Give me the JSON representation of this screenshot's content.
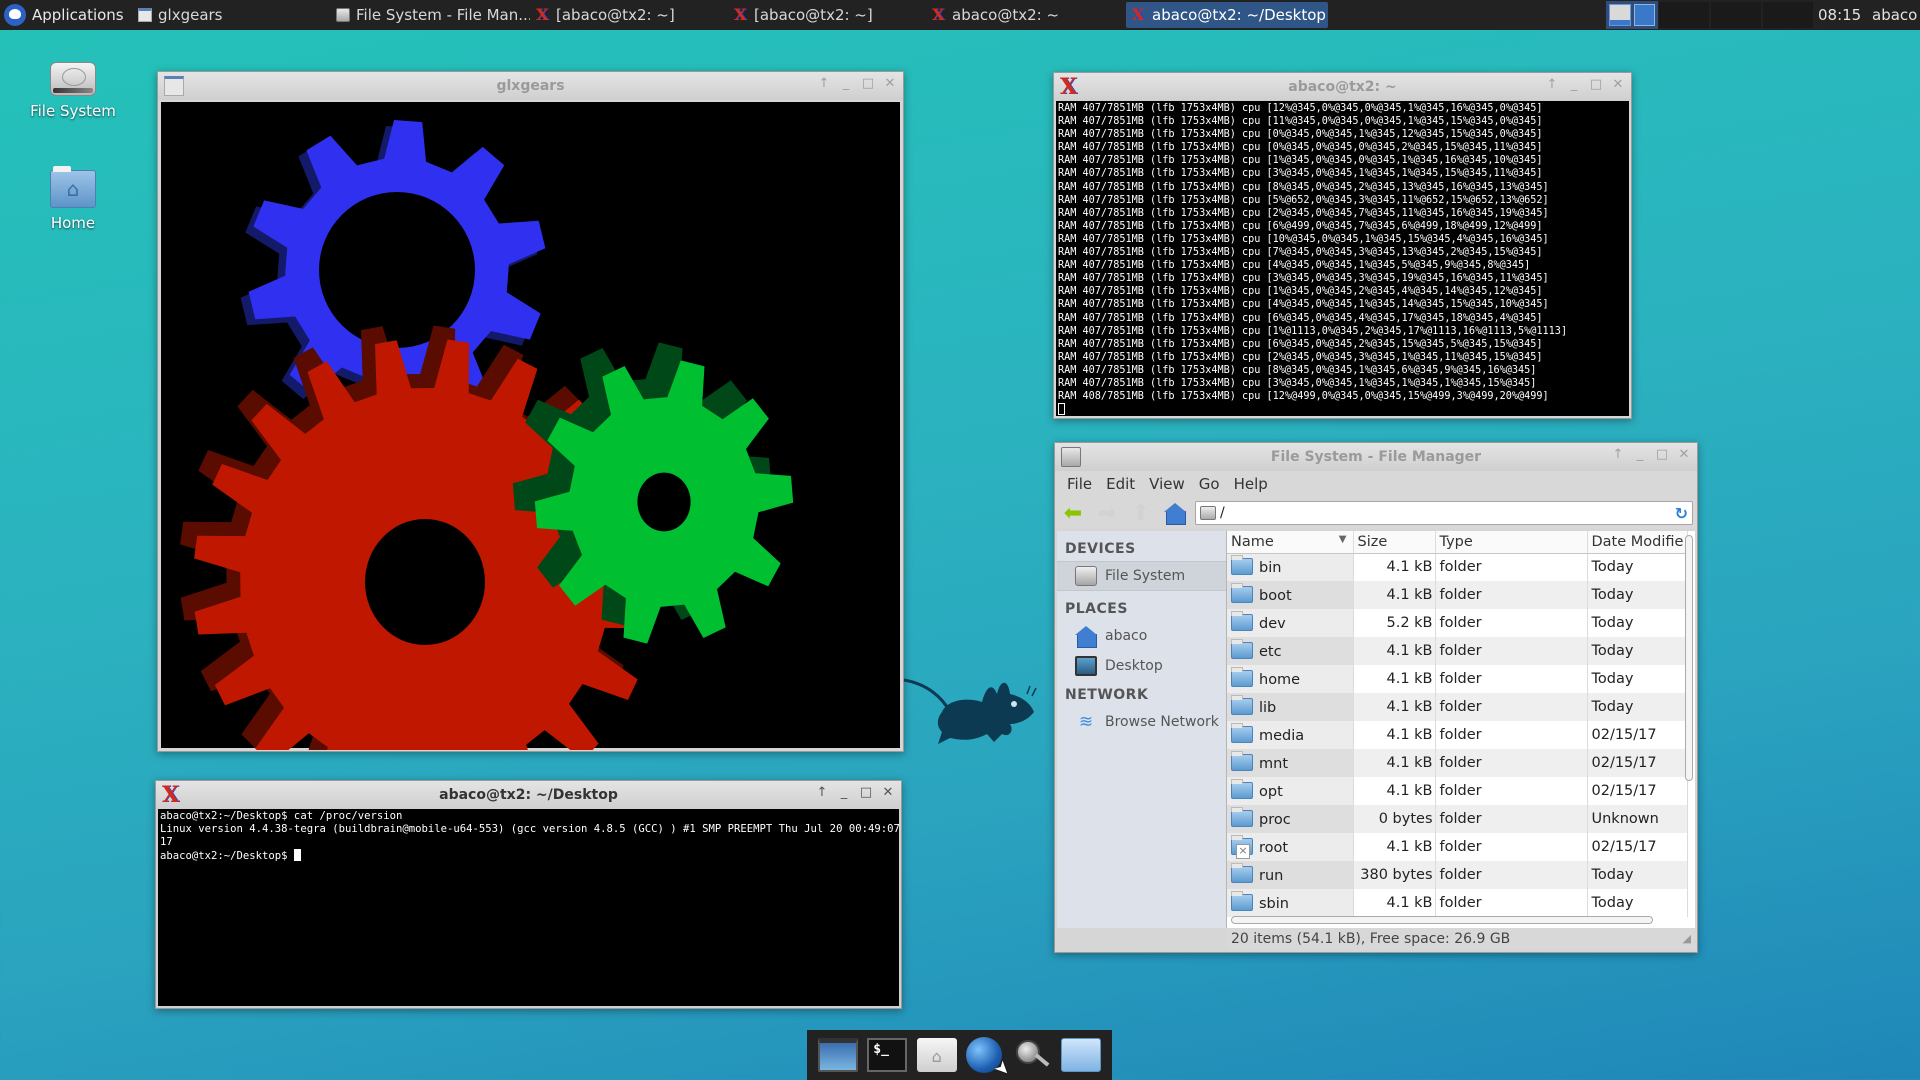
{
  "panel": {
    "applications_label": "Applications",
    "tasks": [
      {
        "label": "glxgears",
        "icon": "window-icon",
        "active": false
      },
      {
        "label": "File System - File Man...",
        "icon": "file-manager-icon",
        "active": false
      },
      {
        "label": "[abaco@tx2: ~]",
        "icon": "xterm-icon",
        "active": false
      },
      {
        "label": "[abaco@tx2: ~]",
        "icon": "xterm-icon",
        "active": false
      },
      {
        "label": "abaco@tx2: ~",
        "icon": "xterm-icon",
        "active": false
      },
      {
        "label": "abaco@tx2: ~/Desktop",
        "icon": "xterm-icon",
        "active": true
      }
    ],
    "workspaces": [
      "1",
      "2"
    ],
    "clock": "08:15",
    "user": "abaco"
  },
  "desktop_icons": [
    {
      "label": "File System",
      "icon": "hard-drive-icon"
    },
    {
      "label": "Home",
      "icon": "home-folder-icon"
    }
  ],
  "glxgears_window": {
    "title": "glxgears",
    "gear_colors": {
      "red": "#c01800",
      "green": "#00bf30",
      "blue": "#3030f0"
    }
  },
  "top_terminal": {
    "title": "abaco@tx2: ~",
    "lines": [
      "RAM 407/7851MB (lfb 1753x4MB) cpu [12%@345,0%@345,0%@345,1%@345,16%@345,0%@345]",
      "RAM 407/7851MB (lfb 1753x4MB) cpu [11%@345,0%@345,0%@345,1%@345,15%@345,0%@345]",
      "RAM 407/7851MB (lfb 1753x4MB) cpu [0%@345,0%@345,1%@345,12%@345,15%@345,0%@345]",
      "RAM 407/7851MB (lfb 1753x4MB) cpu [0%@345,0%@345,0%@345,2%@345,15%@345,11%@345]",
      "RAM 407/7851MB (lfb 1753x4MB) cpu [1%@345,0%@345,0%@345,1%@345,16%@345,10%@345]",
      "RAM 407/7851MB (lfb 1753x4MB) cpu [3%@345,0%@345,1%@345,1%@345,15%@345,11%@345]",
      "RAM 407/7851MB (lfb 1753x4MB) cpu [8%@345,0%@345,2%@345,13%@345,16%@345,13%@345]",
      "RAM 407/7851MB (lfb 1753x4MB) cpu [5%@652,0%@345,3%@345,11%@652,15%@652,13%@652]",
      "RAM 407/7851MB (lfb 1753x4MB) cpu [2%@345,0%@345,7%@345,11%@345,16%@345,19%@345]",
      "RAM 407/7851MB (lfb 1753x4MB) cpu [6%@499,0%@345,7%@345,6%@499,18%@499,12%@499]",
      "RAM 407/7851MB (lfb 1753x4MB) cpu [10%@345,0%@345,1%@345,15%@345,4%@345,16%@345]",
      "RAM 407/7851MB (lfb 1753x4MB) cpu [7%@345,0%@345,3%@345,13%@345,2%@345,15%@345]",
      "RAM 407/7851MB (lfb 1753x4MB) cpu [4%@345,0%@345,1%@345,5%@345,9%@345,8%@345]",
      "RAM 407/7851MB (lfb 1753x4MB) cpu [3%@345,0%@345,3%@345,19%@345,16%@345,11%@345]",
      "RAM 407/7851MB (lfb 1753x4MB) cpu [1%@345,0%@345,2%@345,4%@345,14%@345,12%@345]",
      "RAM 407/7851MB (lfb 1753x4MB) cpu [4%@345,0%@345,1%@345,14%@345,15%@345,10%@345]",
      "RAM 407/7851MB (lfb 1753x4MB) cpu [6%@345,0%@345,4%@345,17%@345,18%@345,4%@345]",
      "RAM 407/7851MB (lfb 1753x4MB) cpu [1%@1113,0%@345,2%@345,17%@1113,16%@1113,5%@1113]",
      "RAM 407/7851MB (lfb 1753x4MB) cpu [6%@345,0%@345,2%@345,15%@345,5%@345,15%@345]",
      "RAM 407/7851MB (lfb 1753x4MB) cpu [2%@345,0%@345,3%@345,1%@345,11%@345,15%@345]",
      "RAM 407/7851MB (lfb 1753x4MB) cpu [8%@345,0%@345,1%@345,6%@345,9%@345,16%@345]",
      "RAM 407/7851MB (lfb 1753x4MB) cpu [3%@345,0%@345,1%@345,1%@345,1%@345,15%@345]",
      "RAM 408/7851MB (lfb 1753x4MB) cpu [12%@499,0%@345,0%@345,15%@499,3%@499,20%@499]"
    ]
  },
  "bottom_terminal": {
    "title": "abaco@tx2: ~/Desktop",
    "lines": [
      "abaco@tx2:~/Desktop$ cat /proc/version",
      "Linux version 4.4.38-tegra (buildbrain@mobile-u64-553) (gcc version 4.8.5 (GCC) ) #1 SMP PREEMPT Thu Jul 20 00:49:07 PDT 20",
      "17"
    ],
    "prompt": "abaco@tx2:~/Desktop$ "
  },
  "file_manager": {
    "title": "File System - File Manager",
    "menu": [
      "File",
      "Edit",
      "View",
      "Go",
      "Help"
    ],
    "location": "/",
    "sidebar": {
      "devices_heading": "DEVICES",
      "devices": [
        {
          "label": "File System",
          "icon": "hard-drive-icon"
        }
      ],
      "places_heading": "PLACES",
      "places": [
        {
          "label": "abaco",
          "icon": "home-icon"
        },
        {
          "label": "Desktop",
          "icon": "desktop-icon"
        }
      ],
      "network_heading": "NETWORK",
      "network": [
        {
          "label": "Browse Network",
          "icon": "wifi-icon"
        }
      ]
    },
    "columns": [
      "Name",
      "Size",
      "Type",
      "Date Modifie"
    ],
    "rows": [
      {
        "name": "bin",
        "size": "4.1 kB",
        "type": "folder",
        "date": "Today"
      },
      {
        "name": "boot",
        "size": "4.1 kB",
        "type": "folder",
        "date": "Today"
      },
      {
        "name": "dev",
        "size": "5.2 kB",
        "type": "folder",
        "date": "Today"
      },
      {
        "name": "etc",
        "size": "4.1 kB",
        "type": "folder",
        "date": "Today"
      },
      {
        "name": "home",
        "size": "4.1 kB",
        "type": "folder",
        "date": "Today"
      },
      {
        "name": "lib",
        "size": "4.1 kB",
        "type": "folder",
        "date": "Today"
      },
      {
        "name": "media",
        "size": "4.1 kB",
        "type": "folder",
        "date": "02/15/17"
      },
      {
        "name": "mnt",
        "size": "4.1 kB",
        "type": "folder",
        "date": "02/15/17"
      },
      {
        "name": "opt",
        "size": "4.1 kB",
        "type": "folder",
        "date": "02/15/17"
      },
      {
        "name": "proc",
        "size": "0 bytes",
        "type": "folder",
        "date": "Unknown"
      },
      {
        "name": "root",
        "size": "4.1 kB",
        "type": "folder",
        "date": "02/15/17",
        "locked": true
      },
      {
        "name": "run",
        "size": "380 bytes",
        "type": "folder",
        "date": "Today"
      },
      {
        "name": "sbin",
        "size": "4.1 kB",
        "type": "folder",
        "date": "Today"
      }
    ],
    "status": "20 items (54.1 kB), Free space: 26.9 GB"
  },
  "dock": [
    {
      "name": "show-desktop",
      "icon": "show-desktop-icon"
    },
    {
      "name": "terminal",
      "icon": "terminal-icon",
      "glyph": "$_"
    },
    {
      "name": "home-folder",
      "icon": "home-folder-icon",
      "glyph": "⌂"
    },
    {
      "name": "web-browser",
      "icon": "globe-icon"
    },
    {
      "name": "app-finder",
      "icon": "magnifier-icon"
    },
    {
      "name": "file-manager",
      "icon": "folder-icon"
    }
  ]
}
